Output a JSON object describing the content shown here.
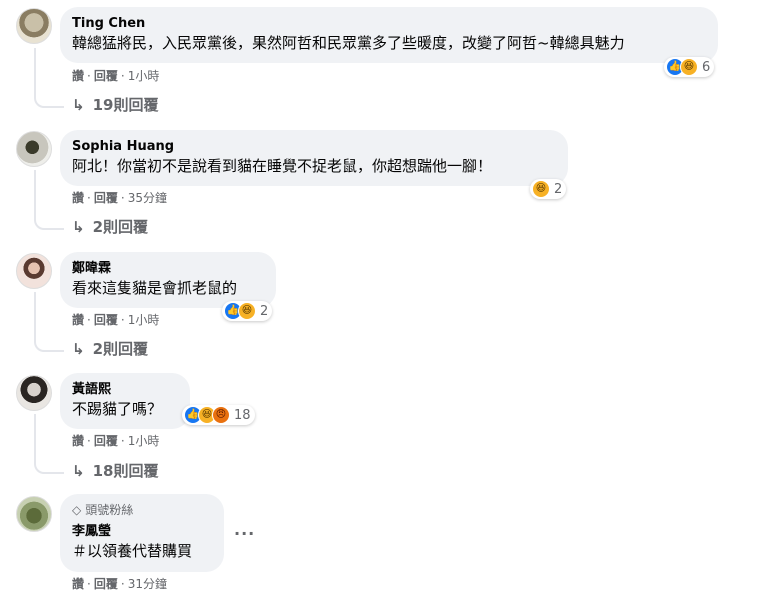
{
  "comments": [
    {
      "author": "Ting Chen",
      "text": "韓總猛將民，入民眾黨後，果然阿哲和民眾黨多了些暖度，改變了阿哲~韓總具魅力",
      "like_label": "讚",
      "reply_label": "回覆",
      "time": "1小時",
      "reactions": [
        "like",
        "haha"
      ],
      "reaction_count": "6",
      "replies": "19則回覆"
    },
    {
      "author": "Sophia Huang",
      "text": "阿北！你當初不是說看到貓在睡覺不捉老鼠，你超想踹他一腳！",
      "like_label": "讚",
      "reply_label": "回覆",
      "time": "35分鐘",
      "reactions": [
        "haha"
      ],
      "reaction_count": "2",
      "replies": "2則回覆"
    },
    {
      "author": "鄭暐霖",
      "text": "看來這隻貓是會抓老鼠的",
      "like_label": "讚",
      "reply_label": "回覆",
      "time": "1小時",
      "reactions": [
        "like",
        "haha"
      ],
      "reaction_count": "2",
      "replies": "2則回覆"
    },
    {
      "author": "黃語熙",
      "text": "不踢貓了嗎？",
      "like_label": "讚",
      "reply_label": "回覆",
      "time": "1小時",
      "reactions": [
        "like",
        "haha",
        "angry"
      ],
      "reaction_count": "18",
      "replies": "18則回覆"
    },
    {
      "badge": "頭號粉絲",
      "author": "李鳳瑩",
      "text": "＃以領養代替購買",
      "like_label": "讚",
      "reply_label": "回覆",
      "time": "31分鐘",
      "more": "···"
    }
  ],
  "colors": {
    "bubble": "#f0f2f5",
    "secondary_text": "#65676b",
    "like": "#1877f2",
    "haha": "#f7b125",
    "angry": "#e9710f"
  },
  "icons": {
    "reply_arrow": "reply-arrow-icon",
    "badge": "diamond-icon",
    "more": "more-options-icon"
  }
}
